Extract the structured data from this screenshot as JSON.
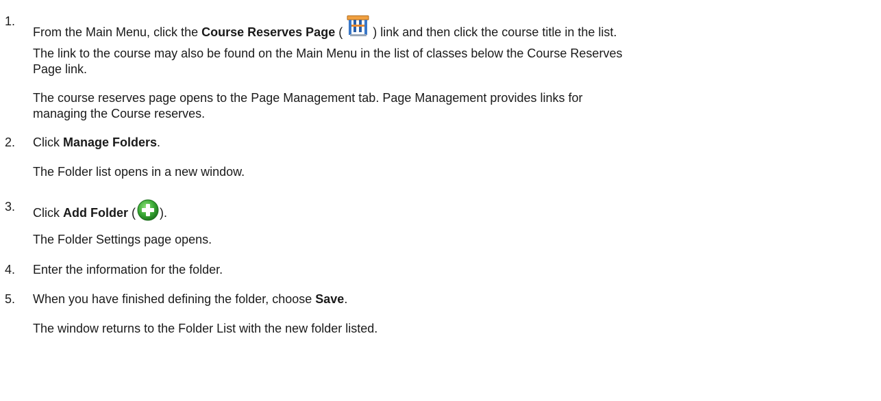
{
  "steps": [
    {
      "number": "1.",
      "pre": "From the Main Menu, click the ",
      "bold": "Course Reserves Page",
      "mid": " (",
      "post": ") link and then click the course title in the list.",
      "icon": "course-reserves-page-icon",
      "notes": [
        [
          "The link to the course may also be found on the Main Menu in the list of classes below the Course Reserves",
          "Page link."
        ],
        [
          "The course reserves page opens to the Page Management tab. Page Management provides links for",
          "managing the Course reserves."
        ]
      ]
    },
    {
      "number": "2.",
      "pre": "Click ",
      "bold": "Manage Folders",
      "post": ".",
      "notes": [
        [
          "The Folder list opens in a new window."
        ]
      ]
    },
    {
      "number": "3.",
      "pre": "Click ",
      "bold": "Add Folder",
      "mid": " (",
      "post": ").",
      "icon": "add-folder-icon",
      "notes": [
        [
          "The Folder Settings page opens."
        ]
      ]
    },
    {
      "number": "4.",
      "pre": "Enter the information for the folder."
    },
    {
      "number": "5.",
      "pre": "When you have finished defining the folder, choose ",
      "bold": "Save",
      "post": ".",
      "notes": [
        [
          "The window returns to the Folder List with the new folder listed."
        ]
      ]
    }
  ],
  "colors": {
    "text": "#1a1a1a",
    "add_icon": "#3aa935",
    "reserve_icon_top": "#f0a040",
    "reserve_icon_legs": "#3a78c8"
  }
}
